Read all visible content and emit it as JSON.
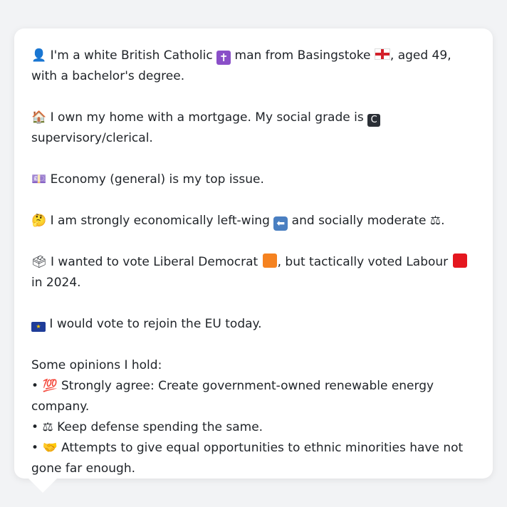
{
  "profile": {
    "identity": {
      "icon": "bust-in-silhouette-icon",
      "text_before_cross": " I'm a white British Catholic ",
      "cross_icon": "latin-cross-icon",
      "cross_glyph": "✝",
      "text_before_flag": " man from Basingstoke ",
      "flag_icon": "england-flag-icon",
      "text_after_flag": ", aged 49, with a bachelor's degree."
    },
    "home": {
      "icon": "house-icon",
      "text_before_badge": " I own my home with a mortgage. My social grade is ",
      "badge_icon": "c-button-icon",
      "badge_glyph": "C",
      "text_after_badge": " supervisory/clerical."
    },
    "issue": {
      "icon": "banknote-icon",
      "text": " Economy (general) is my top issue."
    },
    "ideology": {
      "icon": "thinking-face-icon",
      "text_before_arrow": " I am strongly economically left-wing ",
      "arrow_icon": "left-arrow-icon",
      "arrow_glyph": "⬅",
      "text_before_scales": " and socially moderate ",
      "scales_icon": "balance-scale-icon",
      "scales_glyph": "⚖",
      "text_after_scales": "."
    },
    "vote": {
      "icon": "ballot-box-icon",
      "text_before_ld": " I wanted to vote Liberal Democrat ",
      "ld_icon": "orange-square-icon",
      "ld_color": "#f58220",
      "text_before_lab": ", but tactically voted Labour ",
      "lab_icon": "red-square-icon",
      "lab_color": "#e4171f",
      "text_after_lab": " in 2024."
    },
    "eu": {
      "icon": "eu-flag-icon",
      "text": " I would vote to rejoin the EU today."
    },
    "opinions_heading": "Some opinions I hold:",
    "opinions": [
      {
        "bullet": "• ",
        "icon": "hundred-points-icon",
        "glyph": "💯",
        "text": " Strongly agree: Create government-owned renewable energy company."
      },
      {
        "bullet": "• ",
        "icon": "balance-scale-icon",
        "glyph": "⚖",
        "text": " Keep defense spending the same."
      },
      {
        "bullet": "• ",
        "icon": "handshake-icon",
        "glyph": "🤝",
        "text": " Attempts to give equal opportunities to ethnic minorities have not gone far enough."
      }
    ]
  },
  "colors": {
    "background": "#f2f3f5",
    "card": "#ffffff",
    "text": "#1f2328"
  }
}
